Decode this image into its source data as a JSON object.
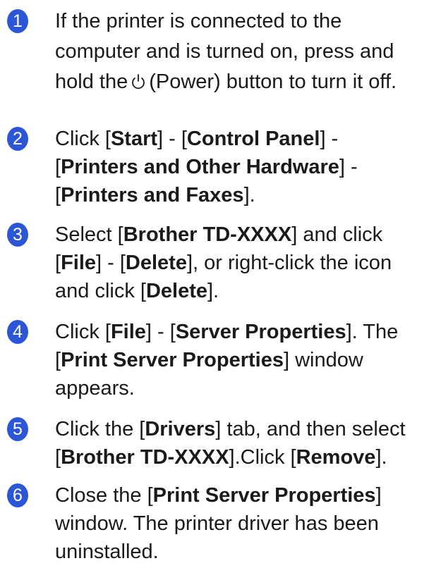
{
  "steps": [
    {
      "number": "1",
      "t1": "If the printer is connected to the",
      "t2": "computer and is turned on, press and",
      "t3a": "hold the",
      "t3b": "(Power) button to turn it off."
    },
    {
      "number": "2",
      "a": "Click [",
      "b": "Start",
      "c": "] - [",
      "d": "Control Panel",
      "e": "] -",
      "f": "[",
      "g": "Printers and Other Hardware",
      "h": "] -",
      "i": "[",
      "j": "Printers and Faxes",
      "k": "]."
    },
    {
      "number": "3",
      "a": "Select [",
      "b": "Brother TD-XXXX",
      "c": "] and click",
      "d": "[",
      "e": "File",
      "f": "] - [",
      "g": "Delete",
      "h": "], or right-click the icon",
      "i": "and click [",
      "j": "Delete",
      "k": "]."
    },
    {
      "number": "4",
      "a": "Click [",
      "b": "File",
      "c": "] - [",
      "d": "Server Properties",
      "e": "]. The",
      "f": "[",
      "g": "Print Server Properties",
      "h": "] window",
      "i": "appears."
    },
    {
      "number": "5",
      "a": "Click the [",
      "b": "Drivers",
      "c": "] tab, and then select",
      "d": "[",
      "e": "Brother TD-XXXX",
      "f": "].Click [",
      "g": "Remove",
      "h": "]."
    },
    {
      "number": "6",
      "a": "Close the [",
      "b": "Print Server Properties",
      "c": "]",
      "d": "window. The printer driver has been",
      "e": "uninstalled."
    }
  ],
  "colors": {
    "badge": "#2b56d8",
    "text": "#1a1a1a"
  },
  "icons": {
    "power": "power-icon"
  }
}
